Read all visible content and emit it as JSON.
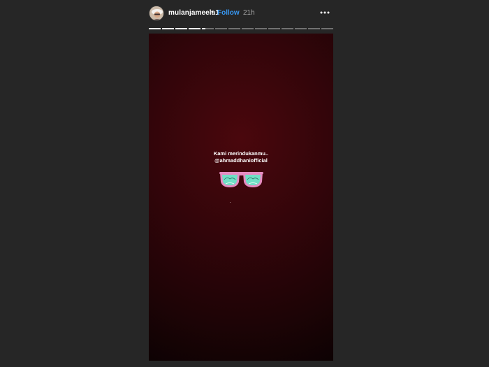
{
  "header": {
    "username": "mulanjameela1",
    "separator": "•",
    "follow_label": "Follow",
    "time_ago": "21h",
    "avatar_icon": "user-avatar",
    "more_icon": "more-options-icon"
  },
  "progress": {
    "segment_count": 14,
    "current_index": 4,
    "current_progress": 0.3
  },
  "story": {
    "caption_line1": "Kami merindukanmu..",
    "caption_line2": "@ahmaddhaniofficial",
    "sticker_icon": "pink-sunglasses-icon"
  },
  "colors": {
    "background": "#262626",
    "follow": "#3897f0",
    "story_bg": "#3a0509",
    "glasses_frame": "#e58cc1",
    "glasses_lens": "#6fe0c6"
  }
}
